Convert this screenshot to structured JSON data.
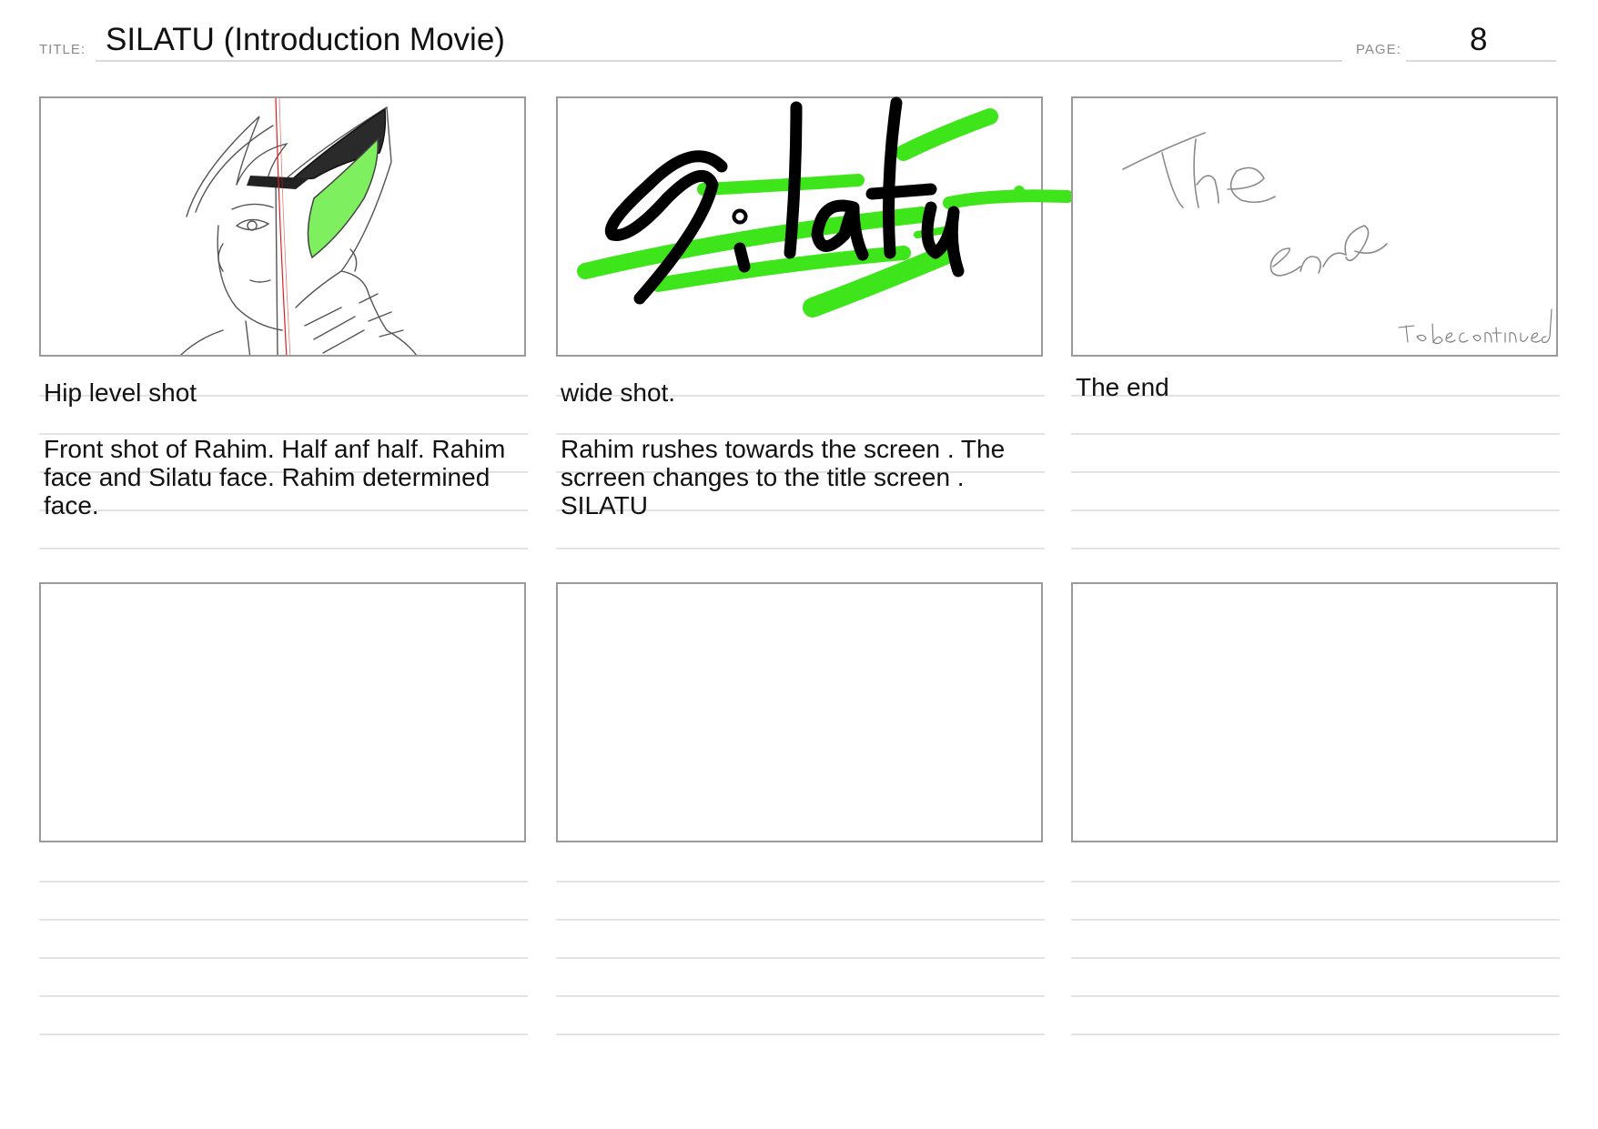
{
  "header": {
    "title_label": "TITLE:",
    "title": "SILATU (Introduction Movie)",
    "page_label": "PAGE:",
    "page_number": "8"
  },
  "panels": [
    {
      "drawing": "sketch of Rahim, half face and half Silatu helmet with green visor",
      "shot": "Hip level shot",
      "description": "Front shot of Rahim. Half anf half. Rahim\nface and Silatu face. Rahim determined\nface."
    },
    {
      "drawing": "Silatu title logo lettering with green brush strokes",
      "logo_text": "Silatu",
      "shot": "wide shot.",
      "description": "Rahim rushes towards the screen . The\nscrreen changes to the title screen .\nSILATU"
    },
    {
      "drawing": "handwritten The end",
      "handwritten_1": "The",
      "handwritten_2": "end",
      "handwritten_3": "To be continued",
      "shot": "The end",
      "description": ""
    },
    {
      "shot": "",
      "description": ""
    },
    {
      "shot": "",
      "description": ""
    },
    {
      "shot": "",
      "description": ""
    }
  ],
  "colors": {
    "accent_green": "#3ee51a",
    "panel_border": "#9a9a9a",
    "rule": "#e3e3e3"
  }
}
